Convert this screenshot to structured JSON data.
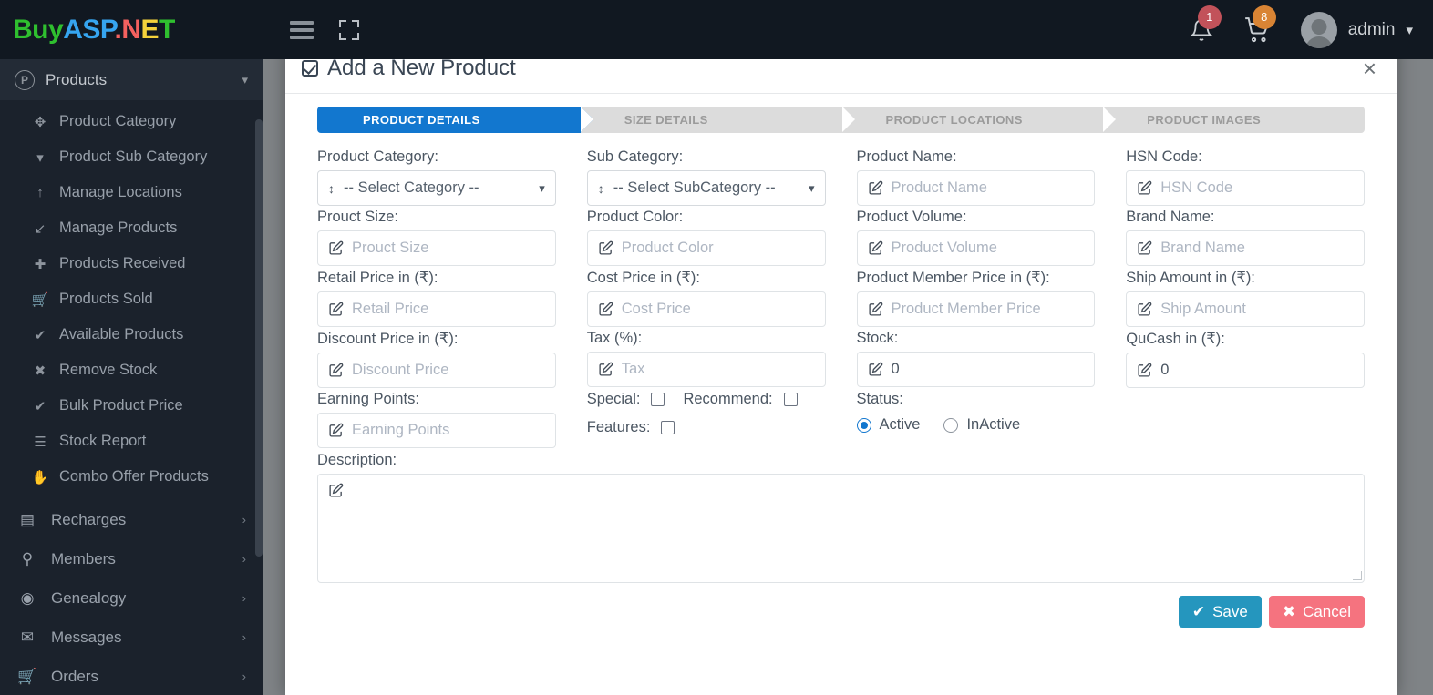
{
  "brand": {
    "part1": "Buy",
    "part2": "ASP",
    "part3": ".",
    "part4": "N",
    "part5": "E",
    "part6": "T"
  },
  "topbar": {
    "menu_icon": "hamburger-icon",
    "fullscreen_icon": "fullscreen-icon",
    "notification_icon": "bell-icon",
    "notification_count": "1",
    "cart_icon": "cart-icon",
    "cart_count": "8",
    "avatar_icon": "user-avatar",
    "username": "admin",
    "caret": "⌄"
  },
  "sidebar": {
    "header": {
      "label": "Products",
      "icon": "P",
      "chevron": "⌄"
    },
    "sub_items": [
      {
        "label": "Product Category",
        "icon": "✥",
        "name": "sidebar-item-product-category"
      },
      {
        "label": "Product Sub Category",
        "icon": "▾",
        "name": "sidebar-item-product-sub-category"
      },
      {
        "label": "Manage Locations",
        "icon": "↑",
        "name": "sidebar-item-manage-locations"
      },
      {
        "label": "Manage Products",
        "icon": "↙",
        "name": "sidebar-item-manage-products"
      },
      {
        "label": "Products Received",
        "icon": "✚",
        "name": "sidebar-item-products-received"
      },
      {
        "label": "Products Sold",
        "icon": "🛒",
        "name": "sidebar-item-products-sold"
      },
      {
        "label": "Available Products",
        "icon": "✔",
        "name": "sidebar-item-available-products"
      },
      {
        "label": "Remove Stock",
        "icon": "✖",
        "name": "sidebar-item-remove-stock"
      },
      {
        "label": "Bulk Product Price",
        "icon": "✔",
        "name": "sidebar-item-bulk-product-price"
      },
      {
        "label": "Stock Report",
        "icon": "☰",
        "name": "sidebar-item-stock-report"
      },
      {
        "label": "Combo Offer Products",
        "icon": "✋",
        "name": "sidebar-item-combo-offer-products"
      }
    ],
    "groups": [
      {
        "label": "Recharges",
        "icon": "▤",
        "arrow": "›",
        "name": "sidebar-group-recharges"
      },
      {
        "label": "Members",
        "icon": "⚲",
        "arrow": "›",
        "name": "sidebar-group-members"
      },
      {
        "label": "Genealogy",
        "icon": "◉",
        "arrow": "›",
        "name": "sidebar-group-genealogy"
      },
      {
        "label": "Messages",
        "icon": "✉",
        "arrow": "›",
        "name": "sidebar-group-messages"
      },
      {
        "label": "Orders",
        "icon": "🛒",
        "arrow": "›",
        "name": "sidebar-group-orders"
      }
    ]
  },
  "modal": {
    "title": "Add a New Product",
    "title_icon": "checkbox-checked-icon",
    "close_label": "×",
    "steps": [
      {
        "label": "PRODUCT DETAILS",
        "active": true
      },
      {
        "label": "SIZE DETAILS",
        "active": false
      },
      {
        "label": "PRODUCT LOCATIONS",
        "active": false
      },
      {
        "label": "PRODUCT IMAGES",
        "active": false
      }
    ],
    "fields": {
      "product_category": {
        "label": "Product Category:",
        "value": "-- Select Category --"
      },
      "sub_category": {
        "label": "Sub Category:",
        "value": "-- Select SubCategory --"
      },
      "product_name": {
        "label": "Product Name:",
        "placeholder": "Product Name"
      },
      "hsn_code": {
        "label": "HSN Code:",
        "placeholder": "HSN Code"
      },
      "product_size": {
        "label": "Prouct Size:",
        "placeholder": "Prouct Size"
      },
      "product_color": {
        "label": "Product Color:",
        "placeholder": "Product Color"
      },
      "product_volume": {
        "label": "Product Volume:",
        "placeholder": "Product Volume"
      },
      "brand_name": {
        "label": "Brand Name:",
        "placeholder": "Brand Name"
      },
      "retail_price": {
        "label": "Retail Price in (₹):",
        "placeholder": "Retail Price"
      },
      "cost_price": {
        "label": "Cost Price in (₹):",
        "placeholder": "Cost Price"
      },
      "member_price": {
        "label": "Product Member Price in (₹):",
        "placeholder": "Product Member Price"
      },
      "ship_amount": {
        "label": "Ship Amount in (₹):",
        "placeholder": "Ship Amount"
      },
      "discount_price": {
        "label": "Discount Price in (₹):",
        "placeholder": "Discount Price"
      },
      "tax": {
        "label": "Tax (%):",
        "placeholder": "Tax"
      },
      "stock": {
        "label": "Stock:",
        "value": "0"
      },
      "qucash": {
        "label": "QuCash in (₹):",
        "value": "0"
      },
      "earning_points": {
        "label": "Earning Points:",
        "placeholder": "Earning Points"
      },
      "description": {
        "label": "Description:",
        "value": ""
      }
    },
    "checkboxes": [
      {
        "label": "Special:",
        "checked": false,
        "name": "special-checkbox"
      },
      {
        "label": "Recommend:",
        "checked": false,
        "name": "recommend-checkbox"
      },
      {
        "label": "Features:",
        "checked": false,
        "name": "features-checkbox"
      }
    ],
    "status": {
      "label": "Status:",
      "options": [
        {
          "label": "Active",
          "selected": true
        },
        {
          "label": "InActive",
          "selected": false
        }
      ]
    },
    "buttons": {
      "save": {
        "label": "Save",
        "icon": "✔",
        "color": "#2596be"
      },
      "cancel": {
        "label": "Cancel",
        "icon": "✖",
        "color": "#f5737f"
      }
    }
  }
}
